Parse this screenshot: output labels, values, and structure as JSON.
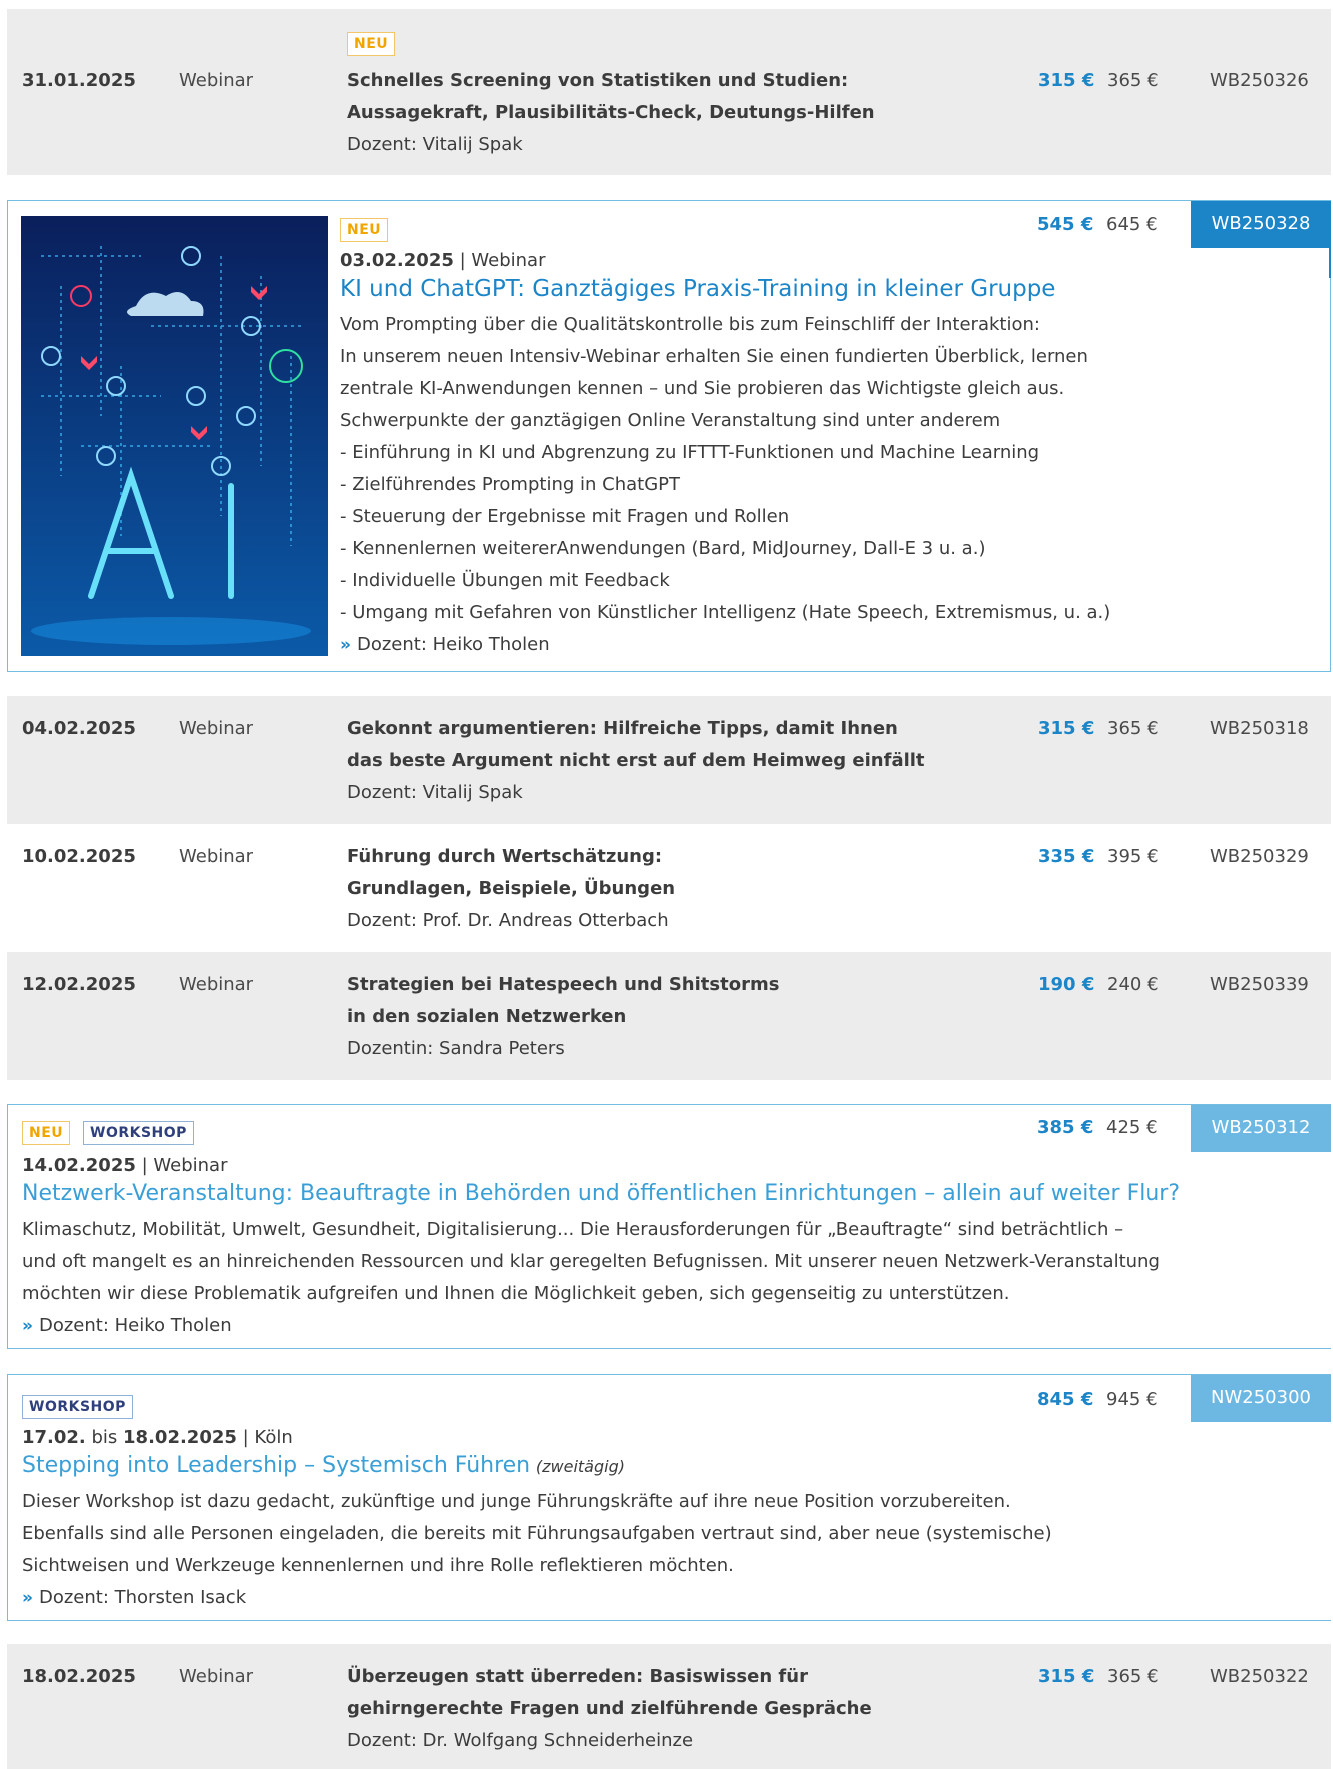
{
  "badges": {
    "neu": "NEU",
    "workshop": "WORKSHOP"
  },
  "events": [
    {
      "date": "31.01.2025",
      "type": "Webinar",
      "title_lines": [
        "Schnelles Screening von Statistiken und Studien:",
        "Aussagekraft, Plausibilitäts-Check, Deutungs-Hilfen"
      ],
      "lecturer": "Dozent: Vitalij Spak",
      "price": "315 €",
      "price_old": "365 €",
      "code": "WB250326"
    },
    {
      "date": "03.02.2025",
      "type_sep": " | Webinar",
      "title": "KI und ChatGPT: Ganztägiges Praxis-Training in kleiner Gruppe",
      "desc_lines": [
        "Vom Prompting über die Qualitätskontrolle bis zum Feinschliff der Interaktion:",
        "In unserem neuen Intensiv-Webinar erhalten Sie einen fundierten Überblick, lernen",
        "zentrale KI-Anwendungen kennen – und Sie probieren das Wichtigste gleich aus.",
        "Schwerpunkte der ganztägigen Online Veranstaltung sind unter anderem",
        "- Einführung in KI und Abgrenzung zu IFTTT-Funktionen und Machine Learning",
        "- Zielführendes Prompting in ChatGPT",
        "- Steuerung der Ergebnisse mit Fragen und Rollen",
        "- Kennenlernen weitererAnwendungen (Bard, MidJourney, Dall-E 3 u. a.)",
        "- Individuelle Übungen mit Feedback",
        "- Umgang mit Gefahren von Künstlicher Intelligenz (Hate Speech, Extremismus, u. a.)"
      ],
      "lecturer": "Dozent: Heiko Tholen",
      "price": "545 €",
      "price_old": "645 €",
      "code": "WB250328"
    },
    {
      "date": "04.02.2025",
      "type": "Webinar",
      "title_lines": [
        "Gekonnt argumentieren: Hilfreiche Tipps, damit Ihnen",
        "das beste Argument nicht erst auf dem Heimweg einfällt"
      ],
      "lecturer": "Dozent: Vitalij Spak",
      "price": "315 €",
      "price_old": "365 €",
      "code": "WB250318"
    },
    {
      "date": "10.02.2025",
      "type": "Webinar",
      "title_lines": [
        "Führung durch Wertschätzung:",
        "Grundlagen, Beispiele, Übungen"
      ],
      "lecturer": "Dozent: Prof. Dr. Andreas Otterbach",
      "price": "335 €",
      "price_old": "395 €",
      "code": "WB250329"
    },
    {
      "date": "12.02.2025",
      "type": "Webinar",
      "title_lines": [
        "Strategien bei Hatespeech und Shitstorms",
        "in den sozialen Netzwerken"
      ],
      "lecturer": "Dozentin: Sandra Peters",
      "price": "190 €",
      "price_old": "240 €",
      "code": "WB250339"
    },
    {
      "date": "14.02.2025",
      "type_sep": " | Webinar",
      "title": "Netzwerk-Veranstaltung: Beauftragte in Behörden und öffentlichen Einrichtungen – allein auf weiter Flur?",
      "desc_lines": [
        "Klimaschutz, Mobilität, Umwelt, Gesundheit, Digitalisierung... Die Herausforderungen für „Beauftragte“ sind beträchtlich –",
        "und oft mangelt es an hinreichenden Ressourcen und klar geregelten Befugnissen. Mit unserer neuen Netzwerk-Veranstaltung",
        "möchten wir diese Problematik aufgreifen und Ihnen die Möglichkeit geben, sich gegenseitig zu unterstützen."
      ],
      "lecturer": "Dozent: Heiko Tholen",
      "price": "385 €",
      "price_old": "425 €",
      "code": "WB250312"
    },
    {
      "date_from": "17.02.",
      "date_bis": " bis ",
      "date_to": "18.02.2025",
      "place_sep": " | Köln",
      "title": "Stepping into Leadership – Systemisch Führen",
      "title_note": "(zweitägig)",
      "desc_lines": [
        "Dieser Workshop ist dazu gedacht, zukünftige und junge Führungskräfte auf ihre neue Position vorzubereiten.",
        "Ebenfalls sind alle Personen eingeladen, die bereits mit Führungsaufgaben vertraut sind, aber neue (systemische)",
        "Sichtweisen und Werkzeuge kennenlernen und ihre Rolle reflektieren möchten."
      ],
      "lecturer": "Dozent: Thorsten Isack",
      "price": "845 €",
      "price_old": "945 €",
      "code": "NW250300"
    },
    {
      "date": "18.02.2025",
      "type": "Webinar",
      "title_lines": [
        "Überzeugen statt überreden: Basiswissen für",
        "gehirngerechte Fragen und zielführende Gespräche"
      ],
      "lecturer": "Dozent: Dr. Wolfgang Schneiderheinze",
      "price": "315 €",
      "price_old": "365 €",
      "code": "WB250322"
    }
  ],
  "icons": {
    "arrow": "double-chevron-right-icon"
  },
  "colors": {
    "accent": "#1c85c8",
    "accent_light": "#6db8e3",
    "neu": "#f0a500",
    "workshop": "#2e3f7c",
    "row_bg": "#ececec"
  }
}
